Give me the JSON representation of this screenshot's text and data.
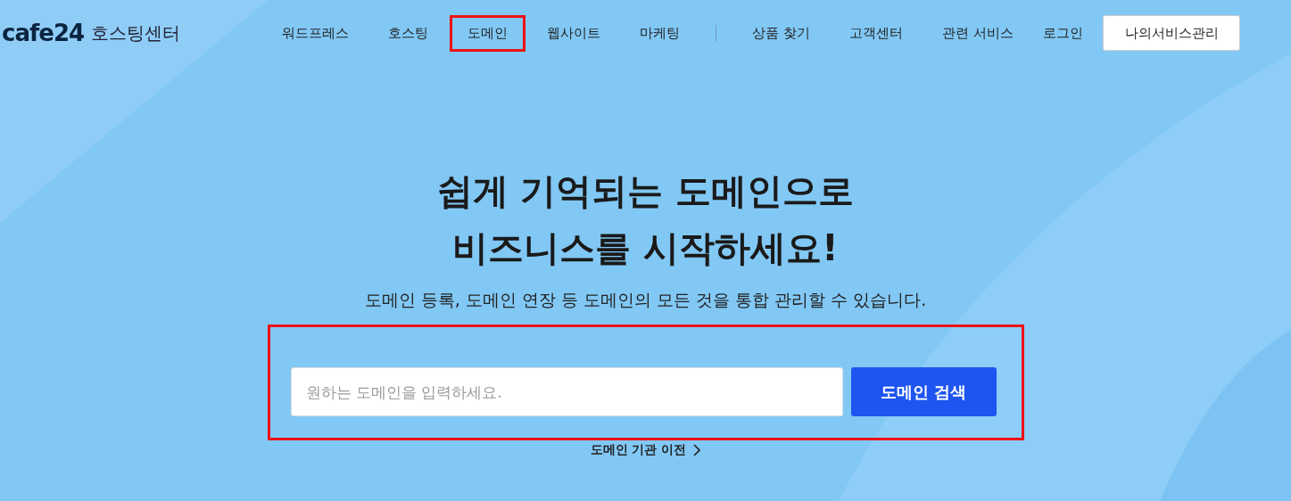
{
  "header": {
    "logo": {
      "brand": "cafe24",
      "subtitle": "호스팅센터"
    },
    "nav_primary": [
      {
        "label": "워드프레스",
        "highlighted": false
      },
      {
        "label": "호스팅",
        "highlighted": false
      },
      {
        "label": "도메인",
        "highlighted": true
      },
      {
        "label": "웹사이트",
        "highlighted": false
      },
      {
        "label": "마케팅",
        "highlighted": false
      }
    ],
    "nav_secondary": [
      {
        "label": "상품 찾기",
        "highlighted": false
      },
      {
        "label": "고객센터",
        "highlighted": false
      },
      {
        "label": "관련 서비스",
        "highlighted": false
      }
    ],
    "login": "로그인",
    "my_services_button": "나의서비스관리"
  },
  "hero": {
    "title_lines": [
      "쉽게 기억되는 도메인으로",
      "비즈니스를 시작하세요!"
    ],
    "subtitle": "도메인 등록, 도메인 연장 등 도메인의 모든 것을 통합 관리할 수 있습니다.",
    "search": {
      "placeholder": "원하는 도메인을 입력하세요.",
      "button": "도메인 검색",
      "highlighted": true
    },
    "transfer_link": "도메인 기관 이전"
  }
}
